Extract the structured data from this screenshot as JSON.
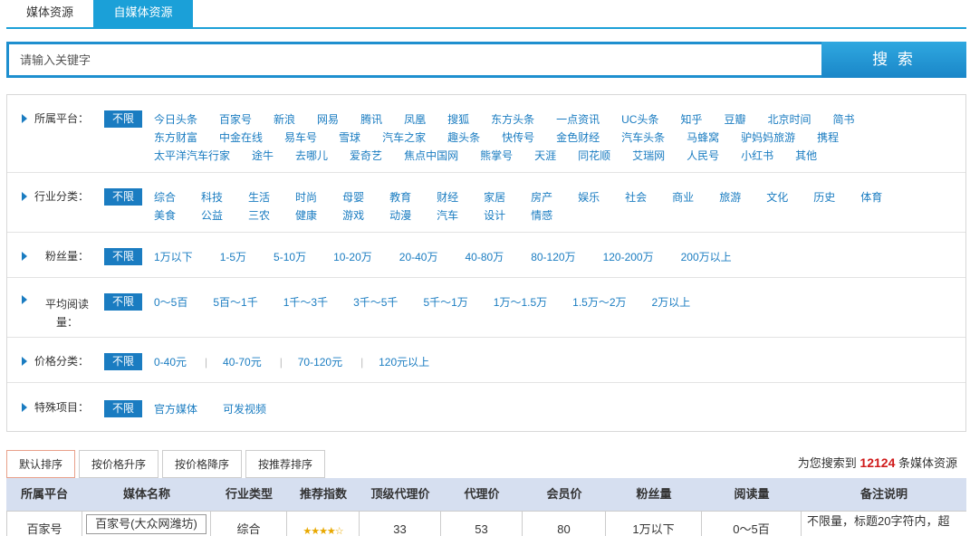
{
  "tabs": [
    "媒体资源",
    "自媒体资源"
  ],
  "search": {
    "placeholder": "请输入关键字",
    "button": "搜 索"
  },
  "filters": {
    "unlimited": "不限",
    "platform": {
      "label": "所属平台：",
      "lines": [
        [
          "今日头条",
          "百家号",
          "新浪",
          "网易",
          "腾讯",
          "凤凰",
          "搜狐",
          "东方头条",
          "一点资讯",
          "UC头条",
          "知乎",
          "豆瓣",
          "北京时间",
          "简书"
        ],
        [
          "东方财富",
          "中金在线",
          "易车号",
          "雪球",
          "汽车之家",
          "趣头条",
          "快传号",
          "金色财经",
          "汽车头条",
          "马蜂窝",
          "驴妈妈旅游",
          "携程"
        ],
        [
          "太平洋汽车行家",
          "途牛",
          "去哪儿",
          "爱奇艺",
          "焦点中国网",
          "熊掌号",
          "天涯",
          "同花顺",
          "艾瑞网",
          "人民号",
          "小红书",
          "其他"
        ]
      ]
    },
    "industry": {
      "label": "行业分类：",
      "lines": [
        [
          "综合",
          "科技",
          "生活",
          "时尚",
          "母婴",
          "教育",
          "财经",
          "家居",
          "房产",
          "娱乐",
          "社会",
          "商业",
          "旅游",
          "文化",
          "历史",
          "体育"
        ],
        [
          "美食",
          "公益",
          "三农",
          "健康",
          "游戏",
          "动漫",
          "汽车",
          "设计",
          "情感"
        ]
      ]
    },
    "fans": {
      "label": "粉丝量：",
      "lines": [
        [
          "1万以下",
          "1-5万",
          "5-10万",
          "10-20万",
          "20-40万",
          "40-80万",
          "80-120万",
          "120-200万",
          "200万以上"
        ]
      ]
    },
    "reads": {
      "label": "平均阅读量：",
      "lines": [
        [
          "0～5百",
          "5百～1千",
          "1千～3千",
          "3千～5千",
          "5千～1万",
          "1万～1.5万",
          "1.5万～2万",
          "2万以上"
        ]
      ]
    },
    "price": {
      "label": "价格分类：",
      "lines": [
        [
          "0-40元",
          "40-70元",
          "70-120元",
          "120元以上"
        ]
      ]
    },
    "special": {
      "label": "特殊项目：",
      "lines": [
        [
          "官方媒体",
          "可发视频"
        ]
      ]
    }
  },
  "sort": [
    "默认排序",
    "按价格升序",
    "按价格降序",
    "按推荐排序"
  ],
  "result": {
    "prefix": "为您搜索到",
    "count": "12124",
    "suffix": "条媒体资源"
  },
  "table": {
    "headers": [
      "所属平台",
      "媒体名称",
      "行业类型",
      "推荐指数",
      "顶级代理价",
      "代理价",
      "会员价",
      "粉丝量",
      "阅读量",
      "备注说明"
    ],
    "rows": [
      {
        "platform": "百家号",
        "name": "百家号(大众网潍坊)",
        "industry": "综合",
        "stars": "★★★★☆",
        "top_price": "33",
        "agent_price": "53",
        "member_price": "80",
        "fans": "1万以下",
        "reads": "0～5百",
        "note": "不限量，标题20字符内，超"
      }
    ]
  }
}
